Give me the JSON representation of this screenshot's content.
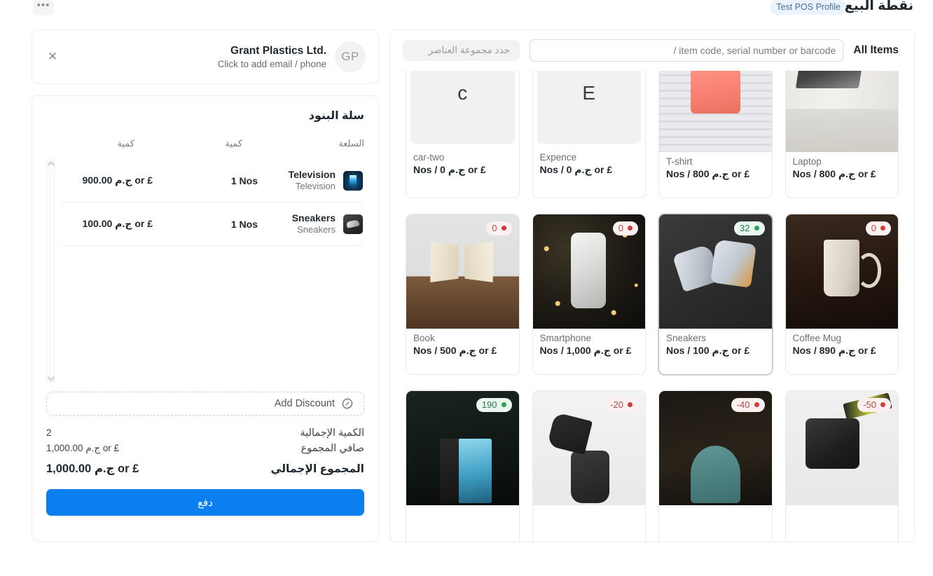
{
  "header": {
    "title": "نقطة البيع",
    "pos_profile_badge": "Test POS Profile",
    "menu_icon": "ellipsis-icon",
    "menu_label": "•••"
  },
  "customer": {
    "initials": "GP",
    "name": "Grant Plastics Ltd.",
    "subtitle": "Click to add email / phone",
    "close_label": "✕"
  },
  "cart": {
    "title": "سلة البنود",
    "columns": {
      "item": "السلعة",
      "qty": "كمية",
      "amount": "كمية"
    },
    "rows": [
      {
        "name": "Television",
        "code": "Television",
        "qty": "1 Nos",
        "amount": "£ or ج.م 900.00",
        "thumb": "television-thumbnail"
      },
      {
        "name": "Sneakers",
        "code": "Sneakers",
        "qty": "1 Nos",
        "amount": "£ or ج.م 100.00",
        "thumb": "sneakers-thumbnail"
      }
    ],
    "discount_label": "Add Discount",
    "discount_icon": "percent-badge-icon",
    "totals": [
      {
        "label": "الكمية الإجمالية",
        "value": "2"
      },
      {
        "label": "صافي المجموع",
        "value": "£ or ج.م 1,000.00"
      }
    ],
    "grand_total": {
      "label": "المجموع الإجمالي",
      "value": "£ or ج.م 1,000.00"
    },
    "pay_button": "دفع"
  },
  "items_panel": {
    "all_items_label": "All Items",
    "search_placeholder": "/ item code, serial number or barcode",
    "search_value": "",
    "item_group_placeholder": "حدد مجموعة العناصر",
    "items": [
      {
        "name": "Laptop",
        "price": "£ or ج.م 800 / Nos",
        "stock": null,
        "stock_state": null,
        "photo": "ph-laptop",
        "placeholder": null,
        "selected": false
      },
      {
        "name": "T-shirt",
        "price": "£ or ج.م 800 / Nos",
        "stock": null,
        "stock_state": null,
        "photo": "ph-tshirt",
        "placeholder": null,
        "selected": false
      },
      {
        "name": "Expence",
        "price": "£ or ج.م 0 / Nos",
        "stock": null,
        "stock_state": null,
        "photo": null,
        "placeholder": "E",
        "selected": false
      },
      {
        "name": "car-two",
        "price": "£ or ج.م 0 / Nos",
        "stock": null,
        "stock_state": null,
        "photo": null,
        "placeholder": "c",
        "selected": false
      },
      {
        "name": "Coffee Mug",
        "price": "£ or ج.م 890 / Nos",
        "stock": "0",
        "stock_state": "red",
        "photo": "ph-mug",
        "placeholder": null,
        "selected": false
      },
      {
        "name": "Sneakers",
        "price": "£ or ج.م 100 / Nos",
        "stock": "32",
        "stock_state": "green",
        "photo": "ph-sneaker",
        "placeholder": null,
        "selected": true
      },
      {
        "name": "Smartphone",
        "price": "£ or ج.م 1,000 / Nos",
        "stock": "0",
        "stock_state": "red",
        "photo": "ph-phone",
        "placeholder": null,
        "selected": false
      },
      {
        "name": "Book",
        "price": "£ or ج.م 500 / Nos",
        "stock": "0",
        "stock_state": "red",
        "photo": "ph-book",
        "placeholder": null,
        "selected": false
      },
      {
        "name": "",
        "price": "",
        "stock": "-50",
        "stock_state": "red",
        "photo": "ph-camera",
        "placeholder": null,
        "selected": false
      },
      {
        "name": "",
        "price": "",
        "stock": "-40",
        "stock_state": "red",
        "photo": "ph-chair",
        "placeholder": null,
        "selected": false
      },
      {
        "name": "",
        "price": "",
        "stock": "-20",
        "stock_state": "red",
        "photo": "ph-bag",
        "placeholder": null,
        "selected": false
      },
      {
        "name": "",
        "price": "",
        "stock": "190",
        "stock_state": "green",
        "photo": "ph-tablet",
        "placeholder": null,
        "selected": false
      }
    ]
  },
  "colors": {
    "accent_blue": "#0b7ef0",
    "badge_bg": "#eaf3ff",
    "badge_text": "#4a6fa5",
    "stock_red_bg": "#fdf0f0",
    "stock_red_text": "#b84a4a",
    "stock_green_bg": "#e9f7ef",
    "stock_green_text": "#2f7a4f"
  }
}
